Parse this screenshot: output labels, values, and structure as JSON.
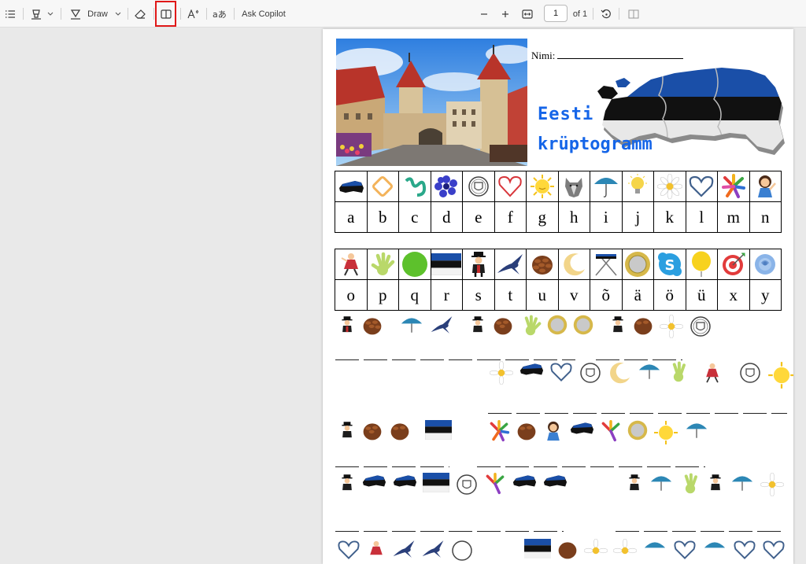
{
  "toolbar": {
    "draw_label": "Draw",
    "ask_copilot_label": "Ask Copilot",
    "page_number": "1",
    "page_total": "of 1",
    "icons": [
      "contents-icon",
      "highlight-icon",
      "chevron-down-icon",
      "draw-icon",
      "chevron-down-icon",
      "eraser-icon",
      "page-view-icon",
      "read-aloud-icon",
      "translate-icon",
      "zoom-out-icon",
      "zoom-in-icon",
      "fit-page-icon",
      "rotate-icon",
      "two-page-icon"
    ]
  },
  "document": {
    "name_label": "Nimi:",
    "title_line1": "Eesti",
    "title_line2": "krüptogramm",
    "title_color": "#1565e8",
    "key_row1_letters": [
      "a",
      "b",
      "c",
      "d",
      "e",
      "f",
      "g",
      "h",
      "i",
      "j",
      "k",
      "l",
      "m",
      "n"
    ],
    "key_row1_icons": [
      "estonia-map-icon",
      "diamond-icon",
      "spiral-icon",
      "cornflower-icon",
      "coat-of-arms-icon",
      "heart-icon",
      "sun-icon",
      "wolf-icon",
      "umbrella-icon",
      "bulb-icon",
      "daisy-icon",
      "heart-outline-icon",
      "hands-icon",
      "girl-icon"
    ],
    "key_row2_letters": [
      "o",
      "p",
      "q",
      "r",
      "s",
      "t",
      "u",
      "v",
      "õ",
      "ä",
      "ö",
      "ü",
      "x",
      "y"
    ],
    "key_row2_icons": [
      "dancer-icon",
      "handprint-icon",
      "green-circle-icon",
      "estonian-flag-icon",
      "chimney-sweep-icon",
      "swallow-icon",
      "pinecone-icon",
      "moon-icon",
      "crossed-flags-icon",
      "euro-coin-icon",
      "skype-icon",
      "balloon-icon",
      "target-icon",
      "rose-icon"
    ]
  }
}
